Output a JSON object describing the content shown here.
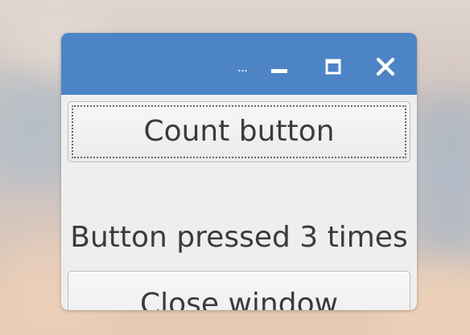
{
  "desktop": {
    "background": "sky-clouds-at-dusk"
  },
  "window": {
    "titlebar_color": "#4d84c6",
    "titlebar": {
      "menu_icon": "ellipsis-icon",
      "menu_glyph": "...",
      "minimize_icon": "minimize-icon",
      "maximize_icon": "maximize-icon",
      "close_icon": "close-icon"
    },
    "count_button_label": "Count button",
    "status_text": "Button pressed 3 times",
    "close_button_label": "Close window"
  }
}
